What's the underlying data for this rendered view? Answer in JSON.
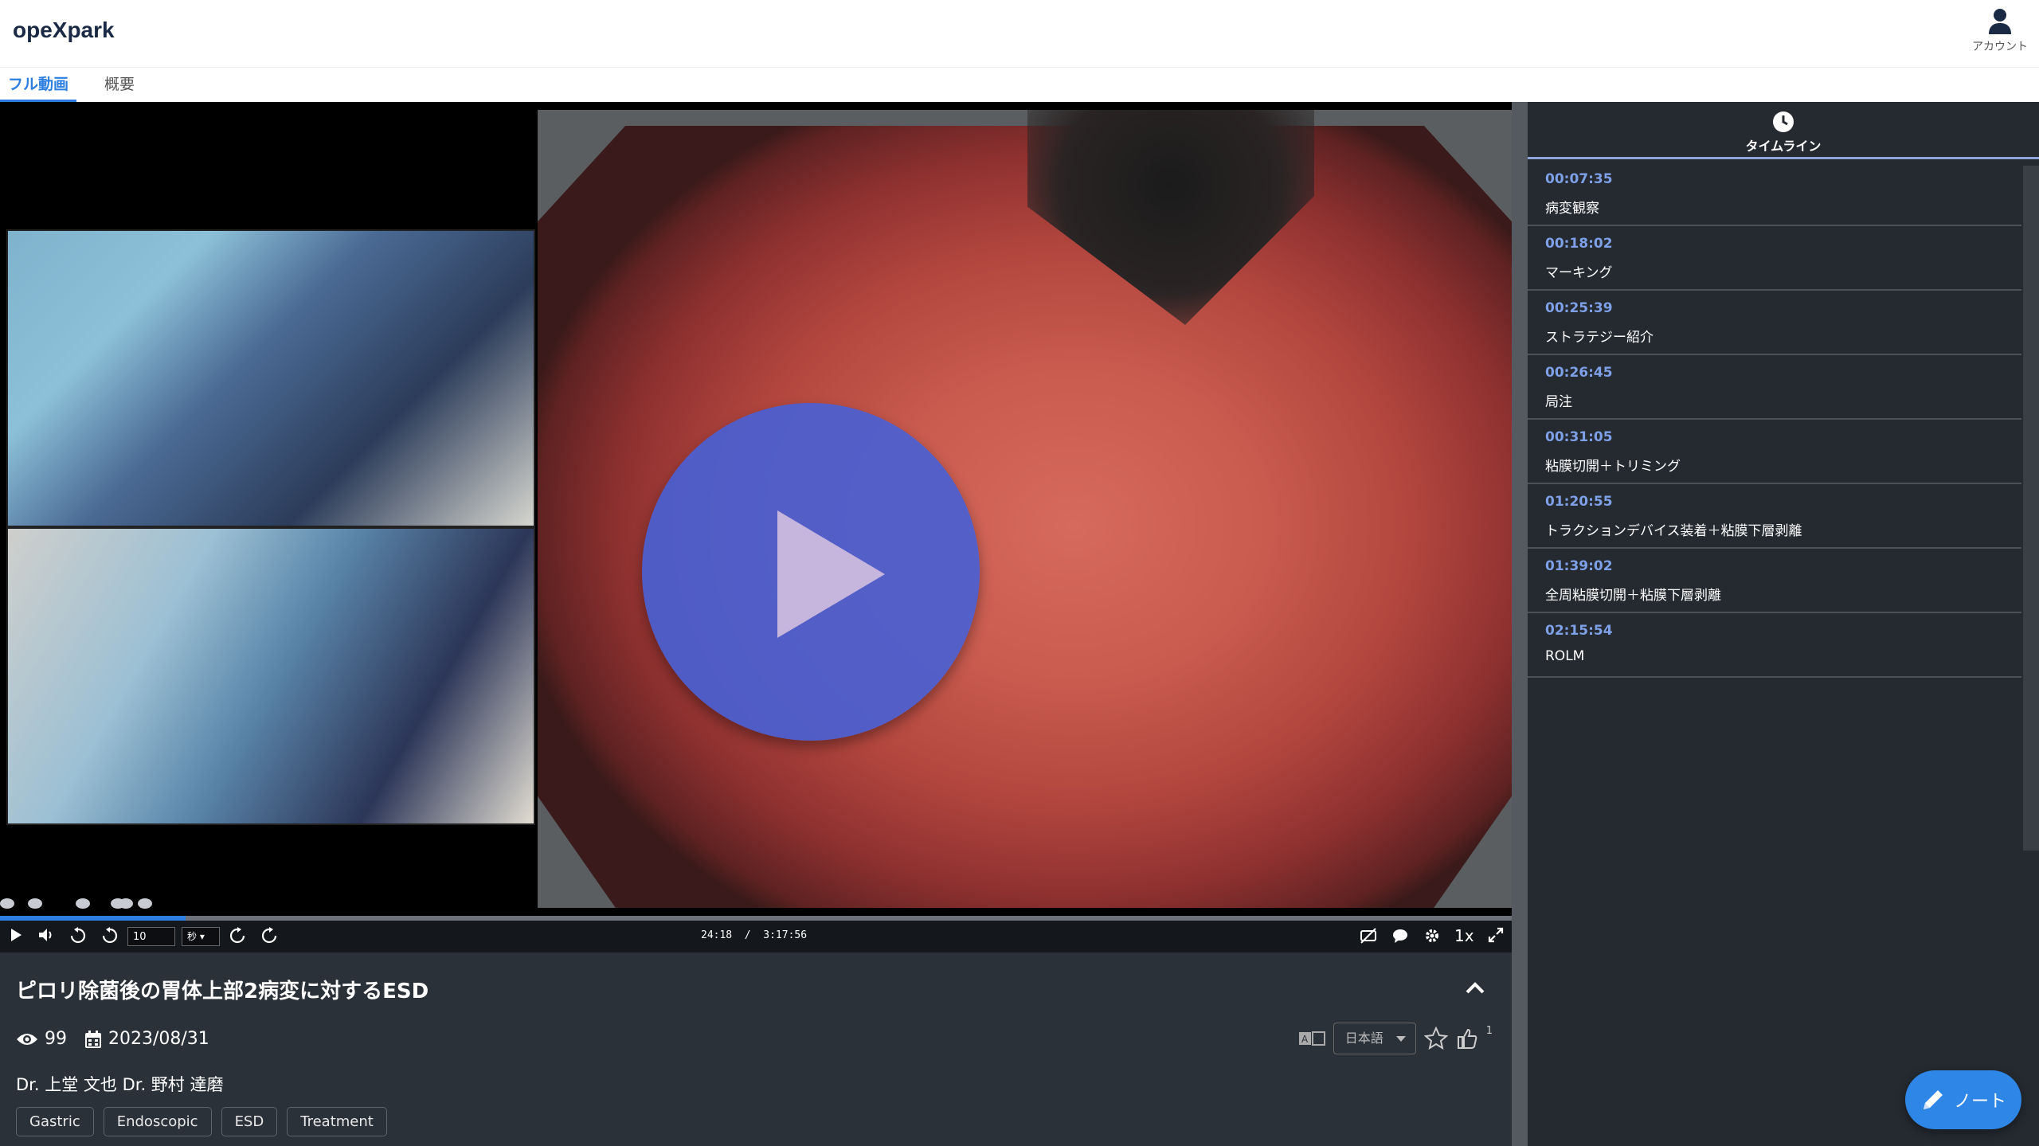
{
  "app": {
    "logo": "opeXpark",
    "account_label": "アカウント"
  },
  "tabs": [
    {
      "label": "フル動画",
      "active": true
    },
    {
      "label": "概要",
      "active": false
    }
  ],
  "player": {
    "skip_seconds": "10",
    "skip_unit": "秒",
    "current_time": "24:18",
    "time_separator": "/",
    "duration": "3:17:56",
    "speed": "1x",
    "progress_fraction": 0.123,
    "marker_fractions": [
      0.002,
      0.023,
      0.055,
      0.078,
      0.083,
      0.096
    ],
    "accent_color": "#2c7fe0",
    "play_button_color": "#4a60d2"
  },
  "video_info": {
    "title": "ピロリ除菌後の胃体上部2病変に対するESD",
    "views": "99",
    "date": "2023/08/31",
    "authors": "Dr. 上堂 文也 Dr. 野村 達磨",
    "tags": [
      "Gastric",
      "Endoscopic",
      "ESD",
      "Treatment"
    ],
    "language": "日本語",
    "like_count": "1"
  },
  "sidebar": {
    "title": "タイムライン",
    "items": [
      {
        "time": "00:07:35",
        "label": "病変観察"
      },
      {
        "time": "00:18:02",
        "label": "マーキング"
      },
      {
        "time": "00:25:39",
        "label": "ストラテジー紹介"
      },
      {
        "time": "00:26:45",
        "label": "局注"
      },
      {
        "time": "00:31:05",
        "label": "粘膜切開＋トリミング"
      },
      {
        "time": "01:20:55",
        "label": "トラクションデバイス装着＋粘膜下層剥離"
      },
      {
        "time": "01:39:02",
        "label": "全周粘膜切開＋粘膜下層剥離"
      },
      {
        "time": "02:15:54",
        "label": "ROLM"
      }
    ]
  },
  "note_button": {
    "label": "ノート"
  },
  "icons": [
    "user-icon",
    "play-icon",
    "volume-icon",
    "rewind-icon",
    "forward-icon",
    "subtitles-off-icon",
    "comment-icon",
    "settings-icon",
    "fullscreen-icon",
    "eye-icon",
    "calendar-icon",
    "translate-icon",
    "star-icon",
    "thumbs-up-icon",
    "clock-icon",
    "pencil-icon",
    "chevron-up-icon"
  ]
}
